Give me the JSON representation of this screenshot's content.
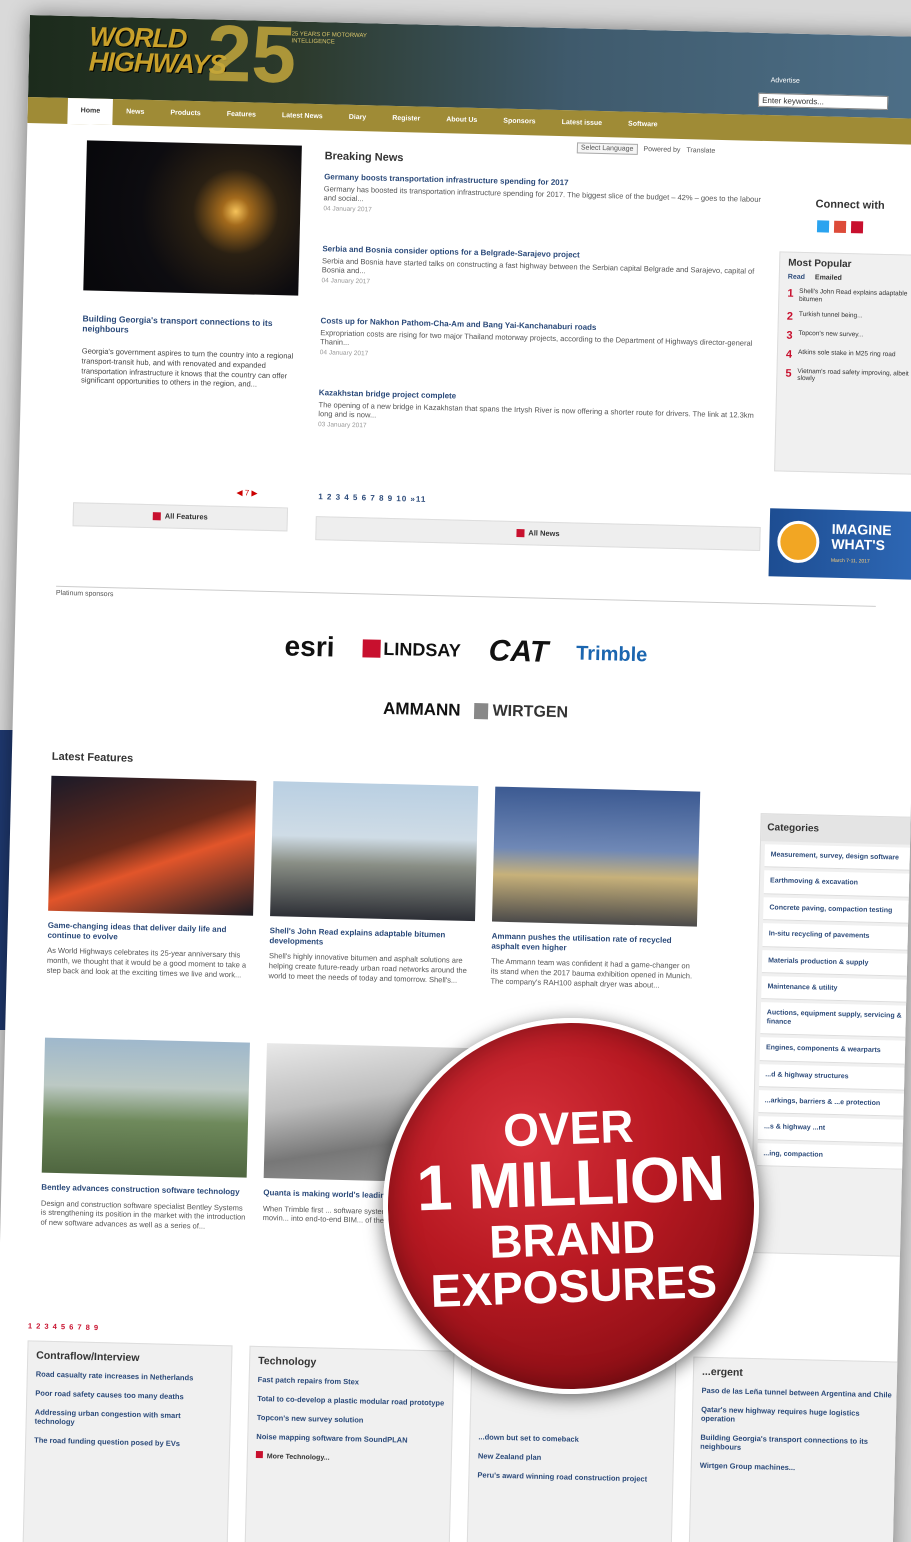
{
  "site": {
    "logo": "WORLD HIGHWAYS",
    "logo_number": "25",
    "tagline": "25 YEARS OF MOTORWAY INTELLIGENCE",
    "advertise_link": "Advertise",
    "search_placeholder": "Enter keywords..."
  },
  "nav": [
    "Home",
    "News",
    "Products",
    "Features",
    "Latest News",
    "Diary",
    "Register",
    "About Us",
    "Sponsors",
    "Latest issue",
    "Software"
  ],
  "language": {
    "select": "Select Language",
    "powered": "Powered by",
    "translate": "Translate"
  },
  "feature": {
    "title": "Building Georgia's transport connections to its neighbours",
    "text": "Georgia's government aspires to turn the country into a regional transport-transit hub, and with renovated and expanded transportation infrastructure it knows that the country can offer significant opportunities to others in the region, and...",
    "pager": "◀ 7 ▶",
    "all_label": "All Features"
  },
  "breaking": {
    "heading": "Breaking News",
    "items": [
      {
        "title": "Germany boosts transportation infrastructure spending for 2017",
        "summary": "Germany has boosted its transportation infrastructure spending for 2017. The biggest slice of the budget – 42% – goes to the labour and social...",
        "date": "04 January 2017"
      },
      {
        "title": "Serbia and Bosnia consider options for a Belgrade-Sarajevo project",
        "summary": "Serbia and Bosnia have started talks on constructing a fast highway between the Serbian capital Belgrade and Sarajevo, capital of Bosnia and...",
        "date": "04 January 2017"
      },
      {
        "title": "Costs up for Nakhon Pathom-Cha-Am and Bang Yai-Kanchanaburi roads",
        "summary": "Expropriation costs are rising for two major Thailand motorway projects, according to the Department of Highways director-general Thanin...",
        "date": "04 January 2017"
      },
      {
        "title": "Kazakhstan bridge project complete",
        "summary": "The opening of a new bridge in Kazakhstan that spans the Irtysh River is now offering a shorter route for drivers. The link at 12.3km long and is now...",
        "date": "03 January 2017"
      }
    ],
    "pager": "1 2 3 4 5 6 7 8 9 10 »11",
    "all_label": "All News"
  },
  "connect": {
    "heading": "Connect with"
  },
  "popular": {
    "heading": "Most Popular",
    "tabs": [
      "Read",
      "Emailed"
    ],
    "items": [
      {
        "n": "1",
        "text": "Shell's John Read explains adaptable bitumen"
      },
      {
        "n": "2",
        "text": "Turkish tunnel being..."
      },
      {
        "n": "3",
        "text": "Topcon's new survey..."
      },
      {
        "n": "4",
        "text": "Atkins sole stake in M25 ring road"
      },
      {
        "n": "5",
        "text": "Vietnam's road safety improving, albeit slowly"
      }
    ]
  },
  "ad": {
    "line1": "IMAGINE",
    "line2": "WHAT'S",
    "small": "March 7-11, 2017"
  },
  "sponsors": {
    "label": "Platinum sponsors",
    "row1": [
      "esri",
      "LINDSAY",
      "CAT",
      "Trimble"
    ],
    "row2": [
      "AMMANN",
      "WIRTGEN"
    ]
  },
  "latest": {
    "heading": "Latest Features",
    "cards": [
      {
        "title": "Game-changing ideas that deliver daily life and continue to evolve",
        "text": "As World Highways celebrates its 25-year anniversary this month, we thought that it would be a good moment to take a step back and look at the exciting times we live and work..."
      },
      {
        "title": "Shell's John Read explains adaptable bitumen developments",
        "text": "Shell's highly innovative bitumen and asphalt solutions are helping create future-ready urban road networks around the world to meet the needs of today and tomorrow. Shell's..."
      },
      {
        "title": "Ammann pushes the utilisation rate of recycled asphalt even higher",
        "text": "The Ammann team was confident it had a game-changer on its stand when the 2017 bauma exhibition opened in Munich. The company's RAH100 asphalt dryer was about..."
      },
      {
        "title": "Bentley advances construction software technology",
        "text": "Design and construction software specialist Bentley Systems is strengthening its position in the market with the introduction of new software advances as well as a series of..."
      },
      {
        "title": "Quanta is making world's leading m... challengers",
        "text": "When Trimble first ... software system a... company was movin... into end-to-end BIM... of the game were..."
      }
    ],
    "pager": "1 2 3 4 5 6 7 8 9"
  },
  "categories": {
    "heading": "Categories",
    "items": [
      "Measurement, survey, design software",
      "Earthmoving & excavation",
      "Concrete paving, compaction testing",
      "In-situ recycling of pavements",
      "Materials production & supply",
      "Maintenance & utility",
      "Auctions, equipment supply, servicing & finance",
      "Engines, components & wearparts",
      "...d & highway structures",
      "...arkings, barriers & ...e protection",
      "...s & highway ...nt",
      "...ing, compaction"
    ]
  },
  "columns": [
    {
      "heading": "Contraflow/Interview",
      "items": [
        "Road casualty rate increases in Netherlands",
        "Poor road safety causes too many deaths",
        "Addressing urban congestion with smart technology",
        "The road funding question posed by EVs"
      ]
    },
    {
      "heading": "Technology",
      "items": [
        "Fast patch repairs from Stex",
        "Total to co-develop a plastic modular road prototype",
        "Topcon's new survey solution",
        "Noise mapping software from SoundPLAN"
      ],
      "more": "More Technology..."
    },
    {
      "heading": "",
      "items": [
        "...down but set to comeback",
        "New Zealand plan",
        "Peru's award winning road construction project"
      ]
    },
    {
      "heading": "...ergent",
      "items": [
        "Paso de las Leña tunnel between Argentina and Chile",
        "Qatar's new highway requires huge logistics operation",
        "Building Georgia's transport connections to its neighbours",
        "Wirtgen Group machines..."
      ]
    }
  ],
  "badge": {
    "line1": "OVER",
    "line2": "1 MILLION",
    "line3": "BRAND",
    "line4": "EXPOSURES"
  },
  "colors": {
    "nav": "#9f8b36",
    "link": "#2b4a7a",
    "badge": "#b81922",
    "accent": "#c8102e"
  }
}
